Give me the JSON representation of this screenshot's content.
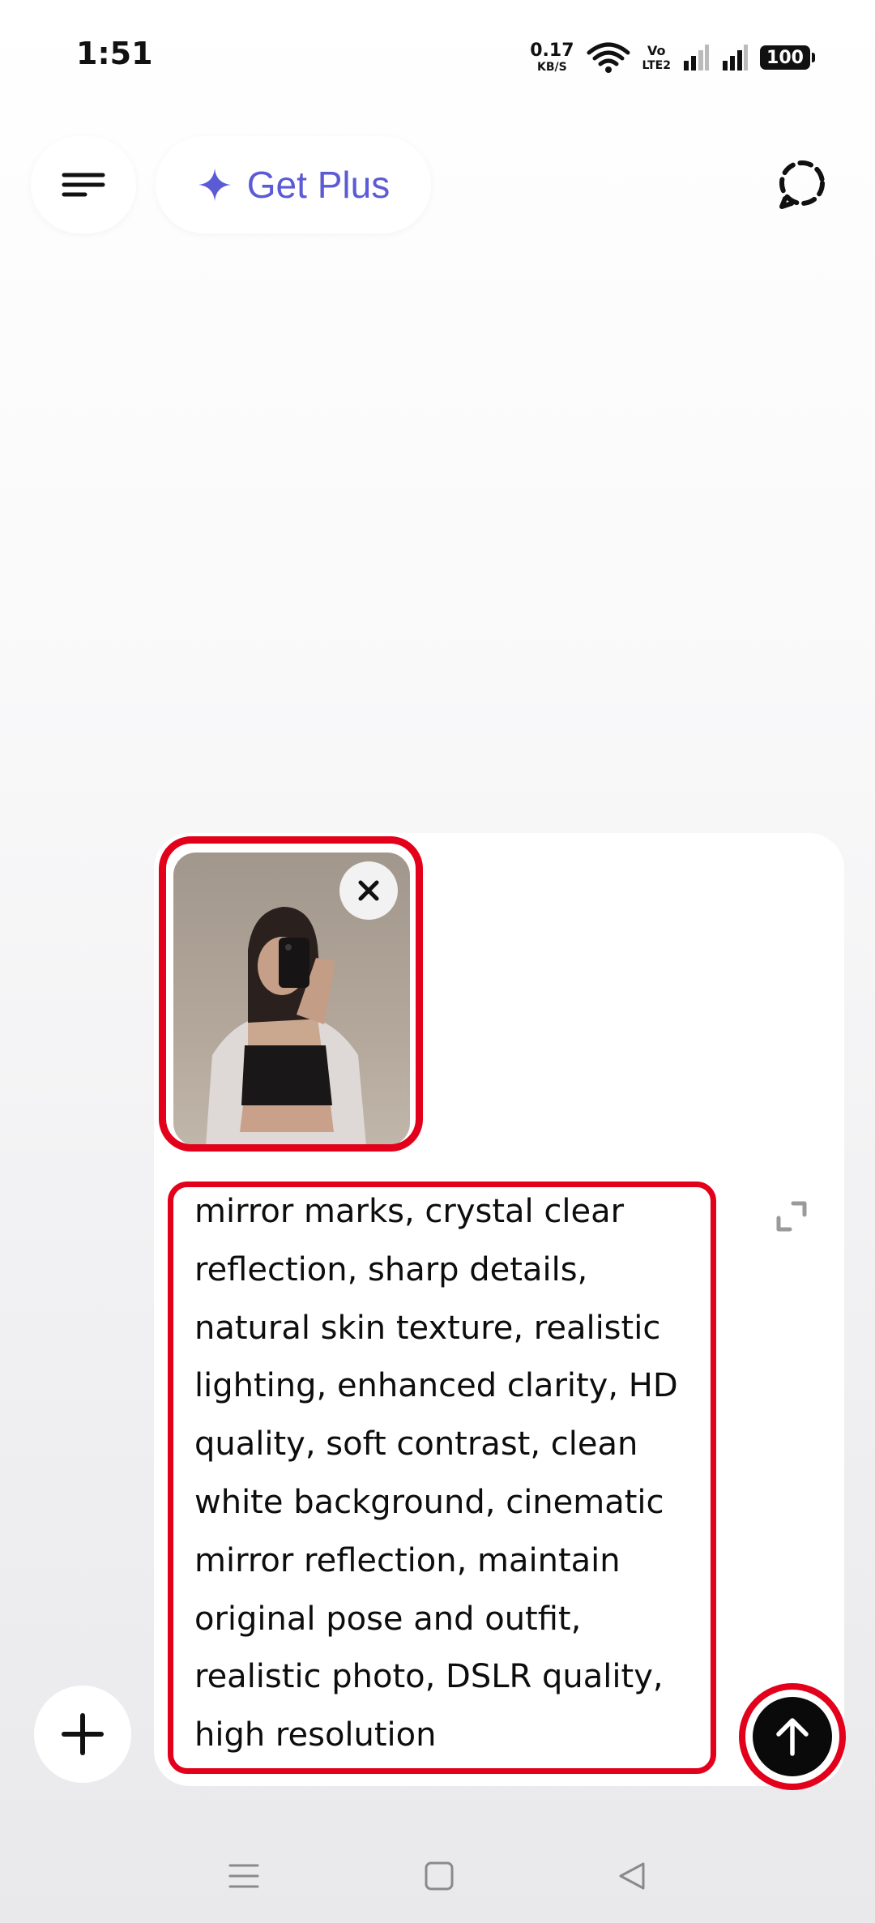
{
  "status_bar": {
    "time": "1:51",
    "net_speed_value": "0.17",
    "net_speed_unit": "KB/S",
    "volte_top": "Vo",
    "volte_bottom": "LTE2",
    "battery": "100"
  },
  "header": {
    "get_plus_label": "Get Plus",
    "accent_color": "#5b5bd6"
  },
  "composer": {
    "prompt_text": "mirror marks, crystal clear\nreflection, sharp details,\nnatural skin texture, realistic\nlighting, enhanced clarity, HD\nquality, soft contrast, clean\nwhite background, cinematic\nmirror reflection, maintain\noriginal pose and outfit,\nrealistic photo, DSLR quality,\nhigh resolution",
    "highlight_color": "#e3001b",
    "attachment": {
      "type": "image"
    }
  },
  "icons": {
    "menu": "menu-icon",
    "get_plus": "sparkle-icon",
    "temp_chat": "dashed-chat-icon",
    "remove_attachment": "close-icon",
    "expand": "expand-icon",
    "add": "plus-icon",
    "send": "arrow-up-icon",
    "nav_recents": "recents-icon",
    "nav_home": "home-icon",
    "nav_back": "back-icon"
  }
}
